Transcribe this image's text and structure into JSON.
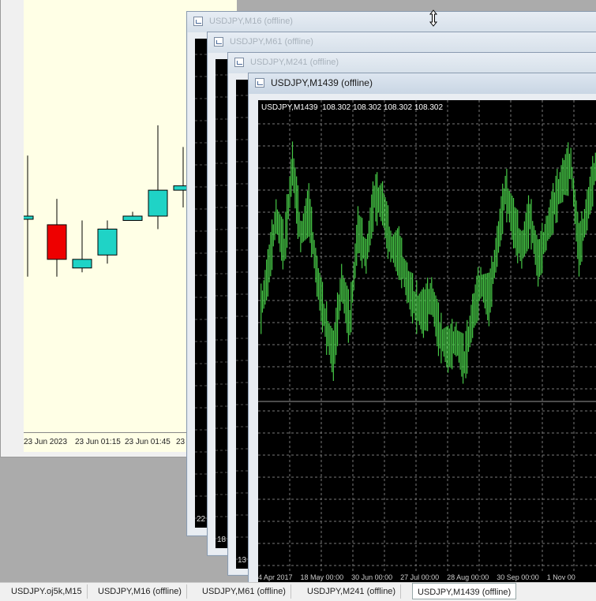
{
  "back_chart": {
    "ticks": [
      "23 Jun 2023",
      "23 Jun 01:15",
      "23 Jun 01:45",
      "23"
    ],
    "candles": [
      {
        "o": 0.5,
        "c": 0.5,
        "h": 0.36,
        "l": 0.64,
        "bull": true
      },
      {
        "o": 0.52,
        "c": 0.6,
        "h": 0.46,
        "l": 0.64,
        "bull": false
      },
      {
        "o": 0.6,
        "c": 0.62,
        "h": 0.51,
        "l": 0.63,
        "bull": true
      },
      {
        "o": 0.59,
        "c": 0.53,
        "h": 0.51,
        "l": 0.61,
        "bull": true
      },
      {
        "o": 0.51,
        "c": 0.5,
        "h": 0.49,
        "l": 0.51,
        "bull": true
      },
      {
        "o": 0.5,
        "c": 0.44,
        "h": 0.29,
        "l": 0.53,
        "bull": true
      },
      {
        "o": 0.44,
        "c": 0.43,
        "h": 0.34,
        "l": 0.48,
        "bull": true
      }
    ],
    "colors": {
      "bull": "#1fd3c6",
      "bear": "#ee0000",
      "background": "#ffffe6"
    }
  },
  "windows": [
    {
      "title": "USDJPY,M16 (offline)",
      "bottom_label": "22"
    },
    {
      "title": "USDJPY,M61 (offline)",
      "bottom_label": "18"
    },
    {
      "title": "USDJPY,M241 (offline)",
      "bottom_label": "13"
    },
    {
      "title": "USDJPY,M1439 (offline)",
      "chart_header": "USDJPY,M1439  108.302 108.302 108.302 108.302",
      "x_axis": "4 Apr 2017    18 May 00:00    30 Jun 00:00    27 Jul 00:00    28 Aug 00:00    30 Sep 00:00    1 Nov 00"
    }
  ],
  "tabs": [
    {
      "label": "USDJPY.oj5k,M15"
    },
    {
      "label": "USDJPY,M16 (offline)"
    },
    {
      "label": "USDJPY,M61 (offline)"
    },
    {
      "label": "USDJPY,M241 (offline)"
    },
    {
      "label": "USDJPY,M1439 (offline)",
      "active": true
    }
  ],
  "chart_data": {
    "type": "line",
    "series": [
      {
        "values": [
          0.42,
          0.55,
          0.72,
          0.62,
          0.88,
          0.66,
          0.74,
          0.54,
          0.4,
          0.3,
          0.52,
          0.4,
          0.68,
          0.6,
          0.78,
          0.76,
          0.63,
          0.61,
          0.52,
          0.45,
          0.43,
          0.48,
          0.36,
          0.32,
          0.35,
          0.28,
          0.42,
          0.52,
          0.47,
          0.63,
          0.8,
          0.7,
          0.62,
          0.72,
          0.58,
          0.67,
          0.76,
          0.83,
          0.88,
          0.62,
          0.74,
          0.87,
          0.66,
          0.73
        ]
      }
    ],
    "colors": {
      "line": "#46c846",
      "grid": "#7a7a7a",
      "background": "#000000"
    }
  }
}
